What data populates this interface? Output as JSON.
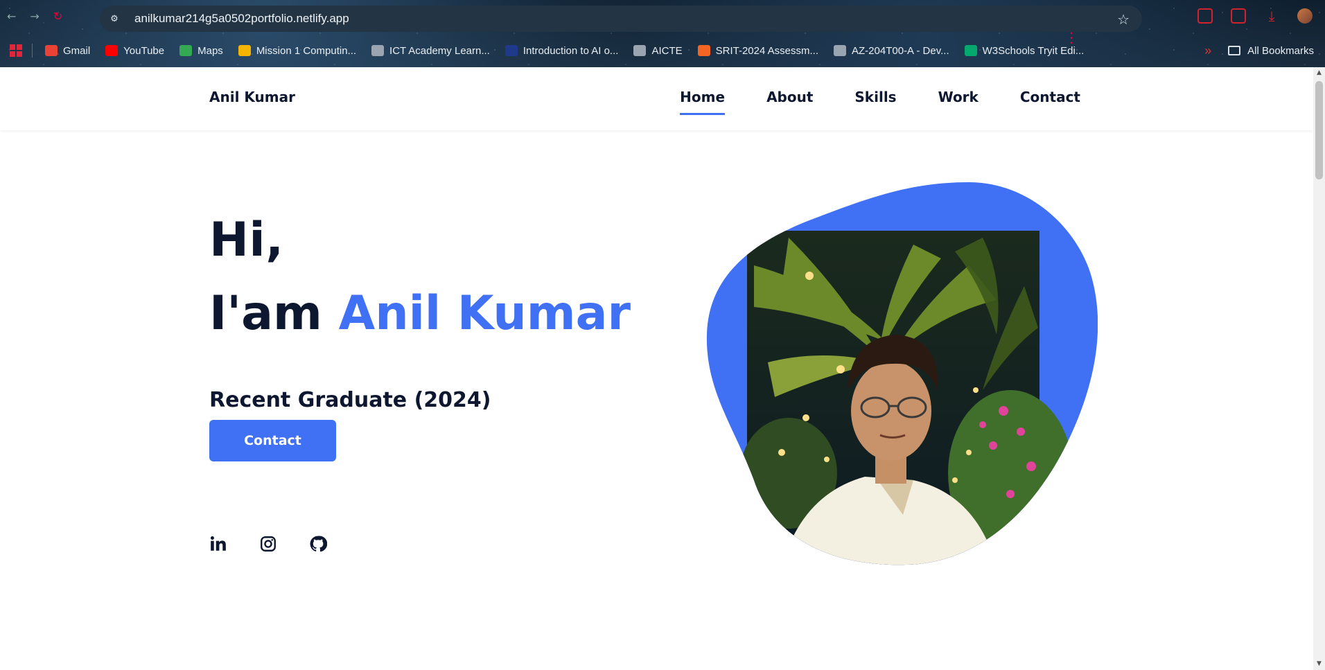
{
  "browser": {
    "url": "anilkumar214g5a0502portfolio.netlify.app",
    "bookmarks": [
      {
        "label": "Gmail",
        "color": "#ea4335"
      },
      {
        "label": "YouTube",
        "color": "#ff0000"
      },
      {
        "label": "Maps",
        "color": "#34a853"
      },
      {
        "label": "Mission 1 Computin...",
        "color": "#f4b400"
      },
      {
        "label": "ICT Academy Learn...",
        "color": "#9aa5b1"
      },
      {
        "label": "Introduction to AI o...",
        "color": "#1f3a8a"
      },
      {
        "label": "AICTE",
        "color": "#9aa5b1"
      },
      {
        "label": "SRIT-2024 Assessm...",
        "color": "#f26522"
      },
      {
        "label": "AZ-204T00-A - Dev...",
        "color": "#9aa5b1"
      },
      {
        "label": "W3Schools Tryit Edi...",
        "color": "#04aa6d"
      }
    ],
    "all_bookmarks": "All Bookmarks"
  },
  "site": {
    "logo": "Anil Kumar",
    "nav": [
      "Home",
      "About",
      "Skills",
      "Work",
      "Contact"
    ],
    "active_nav": "Home",
    "accent_color": "#4070f4"
  },
  "hero": {
    "greeting": "Hi,",
    "intro_prefix": "I'am",
    "name": "Anil Kumar",
    "subtitle": "Recent Graduate (2024)",
    "button": "Contact",
    "social_icons": [
      "linkedin-icon",
      "instagram-icon",
      "github-icon"
    ]
  }
}
